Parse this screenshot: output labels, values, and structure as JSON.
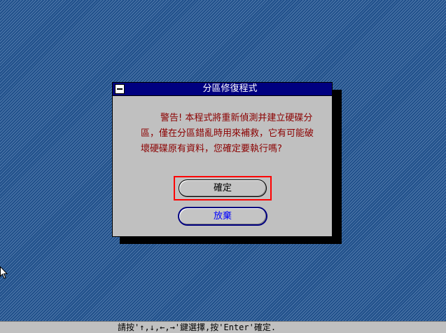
{
  "dialog": {
    "title": "分區修復程式",
    "message": "警告! 本程式將重新偵測并建立硬碟分區，僅在分區錯亂時用來補救，它有可能破壞硬碟原有資料，您確定要執行嗎?",
    "ok_label": "確定",
    "cancel_label": "放棄"
  },
  "statusbar": {
    "hint": "請按'↑,↓,←,→'鍵選擇,按'Enter'確定."
  },
  "icons": {
    "system_menu": "system-menu-icon",
    "cursor": "mouse-pointer-icon"
  },
  "colors": {
    "desktop": "#1f4f8a",
    "titlebar": "#000080",
    "dialog_bg": "#c0c0c0",
    "warning_text": "#8b0000",
    "focus_ring": "#ff0000",
    "cancel_text": "#0000ff"
  }
}
